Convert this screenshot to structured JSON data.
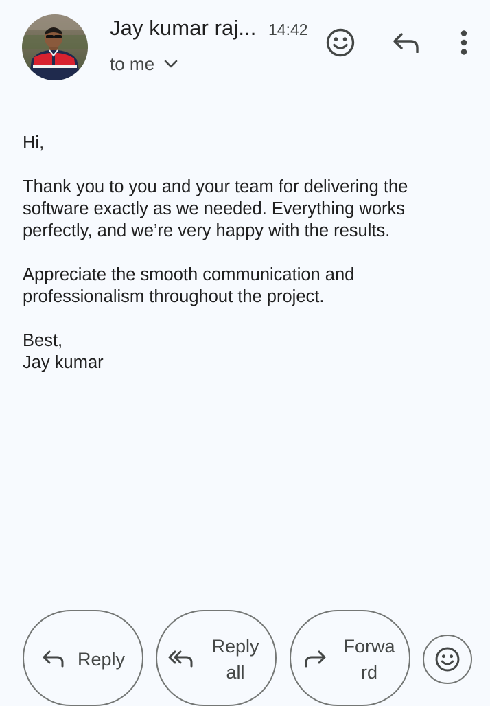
{
  "header": {
    "sender_name": "Jay kumar raj...",
    "time": "14:42",
    "recipient": "to me",
    "icons": {
      "emoji": "add-reaction-icon",
      "reply": "reply-icon",
      "more": "more-vert-icon",
      "chevron": "chevron-down-icon"
    }
  },
  "message": {
    "greeting": "Hi,",
    "paragraph_1": "Thank you to you and your team for delivering the software exactly as we needed. Everything works perfectly, and we’re very happy with the results.",
    "paragraph_2": "Appreciate the smooth communication and professionalism throughout the project.",
    "signoff": "Best,",
    "signature": "Jay kumar"
  },
  "actions": {
    "reply_label": "Reply",
    "reply_all_line_1": "Reply",
    "reply_all_line_2": "all",
    "forward_line_1": "Forwa",
    "forward_line_2": "rd"
  },
  "colors": {
    "background": "#f7fafe",
    "text_primary": "#1f1f1f",
    "text_secondary": "#444746",
    "outline": "#747775"
  }
}
